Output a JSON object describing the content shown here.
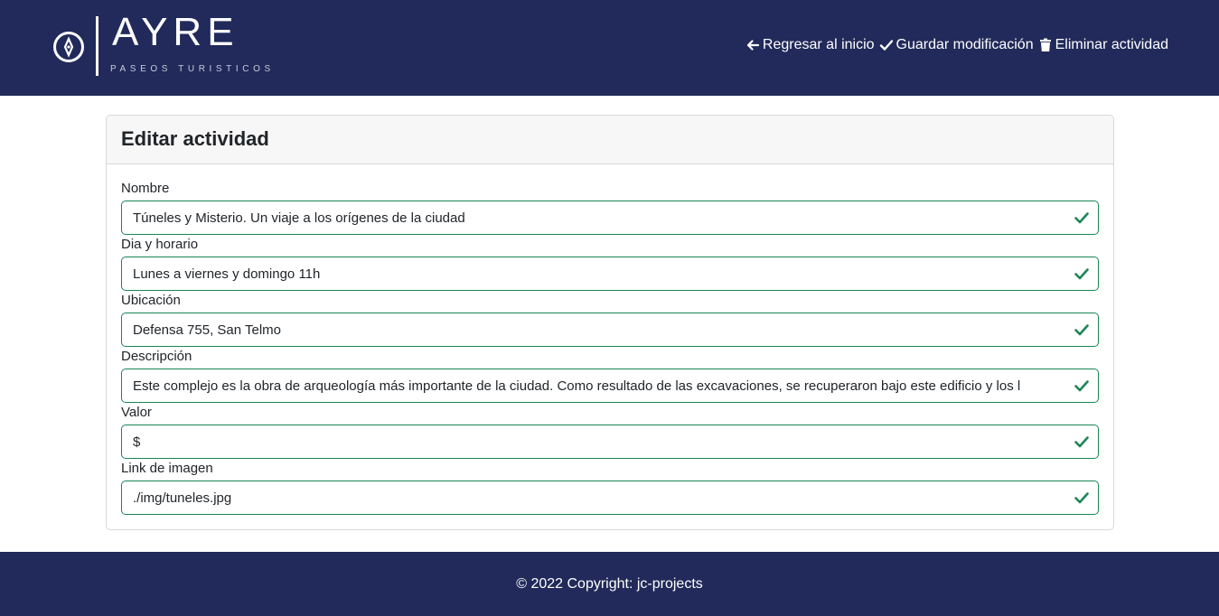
{
  "brand": {
    "name": "AYRE",
    "tagline": "PASEOS TURISTICOS",
    "icon": "compass-icon"
  },
  "nav": {
    "items": [
      {
        "label": "Regresar al inicio",
        "icon": "arrow-left-icon"
      },
      {
        "label": "Guardar modificación",
        "icon": "check-icon"
      },
      {
        "label": "Eliminar actividad",
        "icon": "trash-icon"
      }
    ]
  },
  "card": {
    "title": "Editar actividad"
  },
  "form": {
    "fields": [
      {
        "label": "Nombre",
        "value": "Túneles y Misterio. Un viaje a los orígenes de la ciudad",
        "state": "valid"
      },
      {
        "label": "Dia y horario",
        "value": "Lunes a viernes y domingo 11h",
        "state": "valid"
      },
      {
        "label": "Ubicación",
        "value": "Defensa 755, San Telmo",
        "state": "valid"
      },
      {
        "label": "Descripción",
        "value": "Este complejo es la obra de arqueología más importante de la ciudad. Como resultado de las excavaciones, se recuperaron bajo este edificio y los l",
        "state": "valid"
      },
      {
        "label": "Valor",
        "value": "$",
        "state": "valid"
      },
      {
        "label": "Link de imagen",
        "value": "./img/tuneles.jpg",
        "state": "valid"
      }
    ]
  },
  "footer": {
    "text": "© 2022 Copyright: jc-projects"
  },
  "colors": {
    "navbar": "#212a5a",
    "valid": "#198754"
  }
}
